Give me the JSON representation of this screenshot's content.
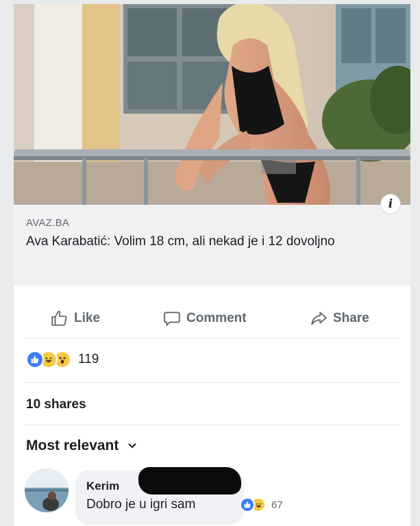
{
  "post": {
    "link_preview": {
      "source": "AVAZ.BA",
      "headline": "Ava Karabatić: Volim 18 cm, ali nekad je i 12 dovoljno",
      "info_icon": "i"
    },
    "actions": [
      {
        "label": "Like",
        "icon": "thumbs-up-icon"
      },
      {
        "label": "Comment",
        "icon": "speech-bubble-icon"
      },
      {
        "label": "Share",
        "icon": "share-arrow-icon"
      }
    ],
    "reactions": {
      "icons": [
        "like-reaction-icon",
        "haha-reaction-icon",
        "wow-reaction-icon"
      ],
      "count": "119"
    },
    "shares_text": "10 shares",
    "sort_label": "Most relevant"
  },
  "comment": {
    "author": "Kerim",
    "text": "Dobro je u igri sam",
    "reaction_icons": [
      "like-reaction-icon",
      "haha-reaction-icon"
    ],
    "reaction_count": "67"
  },
  "colors": {
    "like_blue": "#3d7df5",
    "reaction_yellow": "#f7c844",
    "action_gray": "#606770",
    "preview_bg": "#f0f1f3"
  }
}
